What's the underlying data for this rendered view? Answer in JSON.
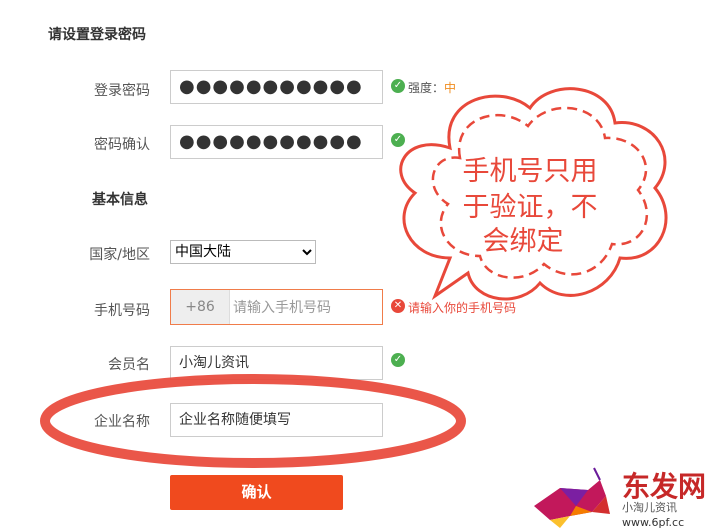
{
  "sections": {
    "password_title": "请设置登录密码",
    "basic_title": "基本信息"
  },
  "fields": {
    "password": {
      "label": "登录密码",
      "value": "●●●●●●●●●●●",
      "strength_label": "强度：",
      "strength_value": "中"
    },
    "confirm": {
      "label": "密码确认",
      "value": "●●●●●●●●●●●"
    },
    "country": {
      "label": "国家/地区",
      "value": "中国大陆"
    },
    "phone": {
      "label": "手机号码",
      "prefix": "+86",
      "placeholder": "请输入手机号码",
      "error": "请输入你的手机号码"
    },
    "member": {
      "label": "会员名",
      "value": "小淘儿资讯"
    },
    "company": {
      "label": "企业名称",
      "value": "企业名称随便填写"
    }
  },
  "buttons": {
    "confirm_label": "确认"
  },
  "annotation": {
    "callout_lines": [
      "手机号只用",
      "于验证，不",
      "会绑定"
    ]
  },
  "watermark": {
    "logo_text": "东发网",
    "caption": "小淘儿资讯",
    "url": "www.6pf.cc"
  },
  "colors": {
    "accent": "#f04a1e",
    "ok": "#4caf50",
    "error": "#e8483a",
    "highlight_ring": "#e8483a"
  }
}
